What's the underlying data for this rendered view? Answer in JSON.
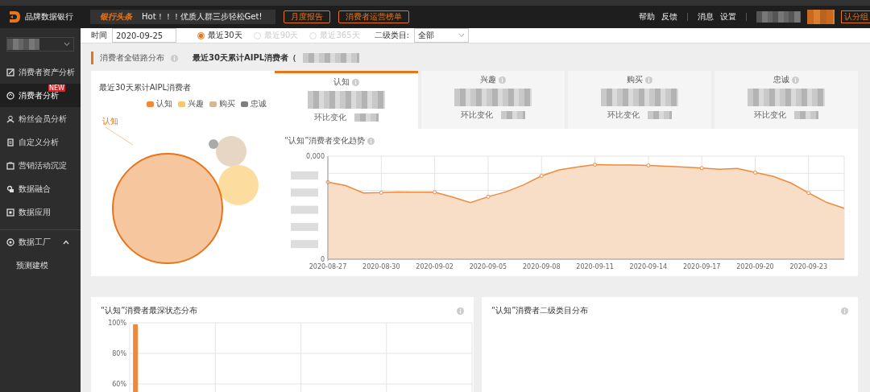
{
  "header": {
    "logo_text": "品牌数据银行",
    "ticker": {
      "tag": "银行头条",
      "text": "Hot！！！优质人群三步轻松Get!"
    },
    "buttons": [
      "月度报告",
      "消费者运营榜单"
    ],
    "links": [
      "帮助",
      "反馈",
      "消息",
      "设置"
    ],
    "group_button": "认分组"
  },
  "sidebar": {
    "items": [
      {
        "label": "消费者资产分析",
        "selected": false
      },
      {
        "label": "消费者分析",
        "selected": true,
        "badge": "NEW"
      },
      {
        "label": "粉丝会员分析",
        "selected": false
      },
      {
        "label": "自定义分析",
        "selected": false
      },
      {
        "label": "营销活动沉淀",
        "selected": false
      },
      {
        "label": "数据融合",
        "selected": false
      },
      {
        "label": "数据应用",
        "selected": false
      },
      {
        "label": "数据工厂",
        "selected": false,
        "expanded": true,
        "children": [
          {
            "label": "预测建模",
            "selected": false
          }
        ]
      }
    ]
  },
  "filter": {
    "date_label": "时间",
    "date_value": "2020-09-25",
    "ranges": [
      {
        "label": "最近30天",
        "selected": true,
        "disabled": false
      },
      {
        "label": "最近90天",
        "selected": false,
        "disabled": true
      },
      {
        "label": "最近365天",
        "selected": false,
        "disabled": true
      }
    ],
    "category_label": "二级类目:",
    "category_value": "全部"
  },
  "section": {
    "title": "消费者全链路分布",
    "subtitle": "最近30天累计AIPL消费者（"
  },
  "bubble_card": {
    "title": "最近30天累计AIPL消费者",
    "legend": [
      {
        "label": "认知",
        "color": "#f0883a"
      },
      {
        "label": "兴趣",
        "color": "#fbc66a"
      },
      {
        "label": "购买",
        "color": "#d6b894"
      },
      {
        "label": "忠诚",
        "color": "#7f7f7f"
      }
    ],
    "bubble_label": "认知"
  },
  "stat_tabs": [
    {
      "label": "认知",
      "selected": true,
      "change_label": "环比变化"
    },
    {
      "label": "兴趣",
      "selected": false,
      "change_label": "环比变化"
    },
    {
      "label": "购买",
      "selected": false,
      "change_label": "环比变化"
    },
    {
      "label": "忠诚",
      "selected": false,
      "change_label": "环比变化"
    }
  ],
  "trend": {
    "title": "“认知”消费者变化趋势",
    "y_labels": [
      "0,000",
      "0"
    ],
    "x_labels": [
      "2020-08-27",
      "2020-08-30",
      "2020-09-02",
      "2020-09-05",
      "2020-09-08",
      "2020-09-11",
      "2020-09-14",
      "2020-09-17",
      "2020-09-20",
      "2020-09-23"
    ]
  },
  "bottom_left": {
    "title": "“认知”消费者最深状态分布",
    "chart_data": {
      "type": "bar",
      "values": [
        99
      ],
      "ylim": [
        60,
        100
      ],
      "yticks": [
        {
          "value": 60,
          "label": "60%"
        },
        {
          "value": 80,
          "label": "80%"
        },
        {
          "value": 100,
          "label": "100%"
        }
      ]
    }
  },
  "bottom_right": {
    "title": "“认知”消费者二级类目分布"
  }
}
